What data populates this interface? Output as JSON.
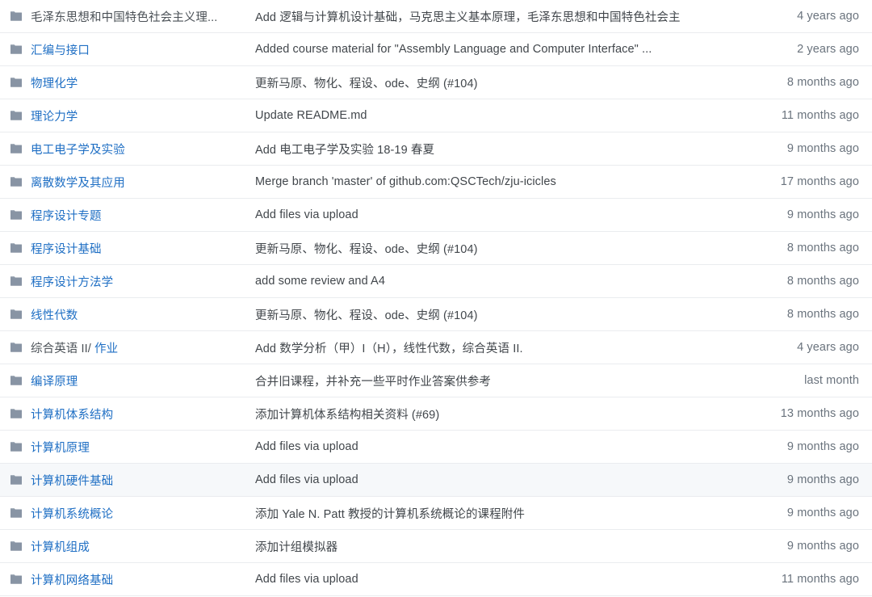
{
  "icons": {
    "folder": "folder-icon"
  },
  "colors": {
    "link": "#1f6fc4",
    "muted_text": "#4a5056",
    "message_text": "#41464b",
    "age_text": "#6a737d",
    "row_border": "#eaecef",
    "row_hover_bg": "#f6f8fa",
    "folder_icon": "#8894a4",
    "background": "#ffffff"
  },
  "file_list": {
    "rows": [
      {
        "name": "毛泽东思想和中国特色社会主义理...",
        "name_style": "muted",
        "message": "Add 逻辑与计算机设计基础，马克思主义基本原理，毛泽东思想和中国特色社会主",
        "age": "4 years ago",
        "highlighted": false
      },
      {
        "name": "汇编与接口",
        "name_style": "link",
        "message": "Added course material for \"Assembly Language and Computer Interface\" ...",
        "age": "2 years ago",
        "highlighted": false
      },
      {
        "name": "物理化学",
        "name_style": "link",
        "message": "更新马原、物化、程设、ode、史纲 (#104)",
        "age": "8 months ago",
        "highlighted": false
      },
      {
        "name": "理论力学",
        "name_style": "link",
        "message": "Update README.md",
        "age": "11 months ago",
        "highlighted": false
      },
      {
        "name": "电工电子学及实验",
        "name_style": "link",
        "message": "Add 电工电子学及实验 18-19 春夏",
        "age": "9 months ago",
        "highlighted": false
      },
      {
        "name": "离散数学及其应用",
        "name_style": "link",
        "message": "Merge branch 'master' of github.com:QSCTech/zju-icicles",
        "age": "17 months ago",
        "highlighted": false
      },
      {
        "name": "程序设计专题",
        "name_style": "link",
        "message": "Add files via upload",
        "age": "9 months ago",
        "highlighted": false
      },
      {
        "name": "程序设计基础",
        "name_style": "link",
        "message": "更新马原、物化、程设、ode、史纲 (#104)",
        "age": "8 months ago",
        "highlighted": false
      },
      {
        "name": "程序设计方法学",
        "name_style": "link",
        "message": "add some review and A4",
        "age": "8 months ago",
        "highlighted": false
      },
      {
        "name": "线性代数",
        "name_style": "link",
        "message": "更新马原、物化、程设、ode、史纲 (#104)",
        "age": "8 months ago",
        "highlighted": false
      },
      {
        "name": "综合英语 II/ 作业",
        "name_style": "split",
        "name_prefix": "综合英语 II/ ",
        "name_suffix": "作业",
        "message": "Add 数学分析（甲）I（H），线性代数，综合英语 II.",
        "age": "4 years ago",
        "highlighted": false
      },
      {
        "name": "编译原理",
        "name_style": "link",
        "message": "合并旧课程，并补充一些平时作业答案供参考",
        "age": "last month",
        "highlighted": false
      },
      {
        "name": "计算机体系结构",
        "name_style": "link",
        "message": "添加计算机体系结构相关资料 (#69)",
        "age": "13 months ago",
        "highlighted": false
      },
      {
        "name": "计算机原理",
        "name_style": "link",
        "message": "Add files via upload",
        "age": "9 months ago",
        "highlighted": false
      },
      {
        "name": "计算机硬件基础",
        "name_style": "link",
        "message": "Add files via upload",
        "age": "9 months ago",
        "highlighted": true
      },
      {
        "name": "计算机系统概论",
        "name_style": "link",
        "message": "添加 Yale N. Patt 教授的计算机系统概论的课程附件",
        "age": "9 months ago",
        "highlighted": false
      },
      {
        "name": "计算机组成",
        "name_style": "link",
        "message": "添加计组模拟器",
        "age": "9 months ago",
        "highlighted": false
      },
      {
        "name": "计算机网络基础",
        "name_style": "link",
        "message": "Add files via upload",
        "age": "11 months ago",
        "highlighted": false
      }
    ]
  }
}
